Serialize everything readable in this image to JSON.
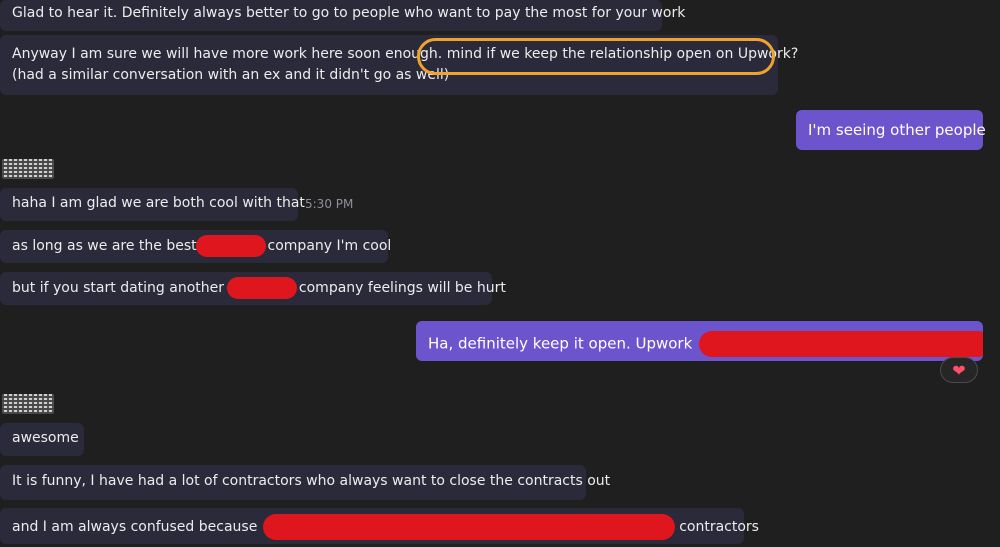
{
  "messages": [
    {
      "text": "Glad to hear it. Definitely always better to go to people who want to pay the most for your work"
    },
    {
      "line1_pre": "Anyway I am sure we will have more work here soon enough.",
      "line1_highlight": "mind if we keep the relationship open on Upwork?",
      "line2": "(had a similar conversation with an ex and it didn't go as well)"
    },
    {
      "text": "I'm seeing other people"
    },
    {
      "text": "haha I am glad we are both cool with that",
      "time": "5:30 PM"
    },
    {
      "pre": "as long as we are the best",
      "post": "company I'm cool"
    },
    {
      "pre": "but if you start dating another",
      "post": "company feelings will be hurt"
    },
    {
      "pre": "Ha, definitely keep it open. Upwork",
      "reaction": "❤"
    },
    {
      "text": "awesome"
    },
    {
      "text": "It is funny, I have had a lot of contractors who always want to close the contracts out"
    },
    {
      "pre": "and I am always confused because",
      "post": "contractors"
    }
  ],
  "colors": {
    "incoming_bubble": "#2b2a3b",
    "outgoing_bubble": "#6b54cc",
    "highlight_ring": "#f0a32c",
    "redaction": "#e0161e",
    "background": "#1f1f1f"
  },
  "icons": {
    "reaction": "heart-icon",
    "avatar": "pixelated-avatar"
  }
}
